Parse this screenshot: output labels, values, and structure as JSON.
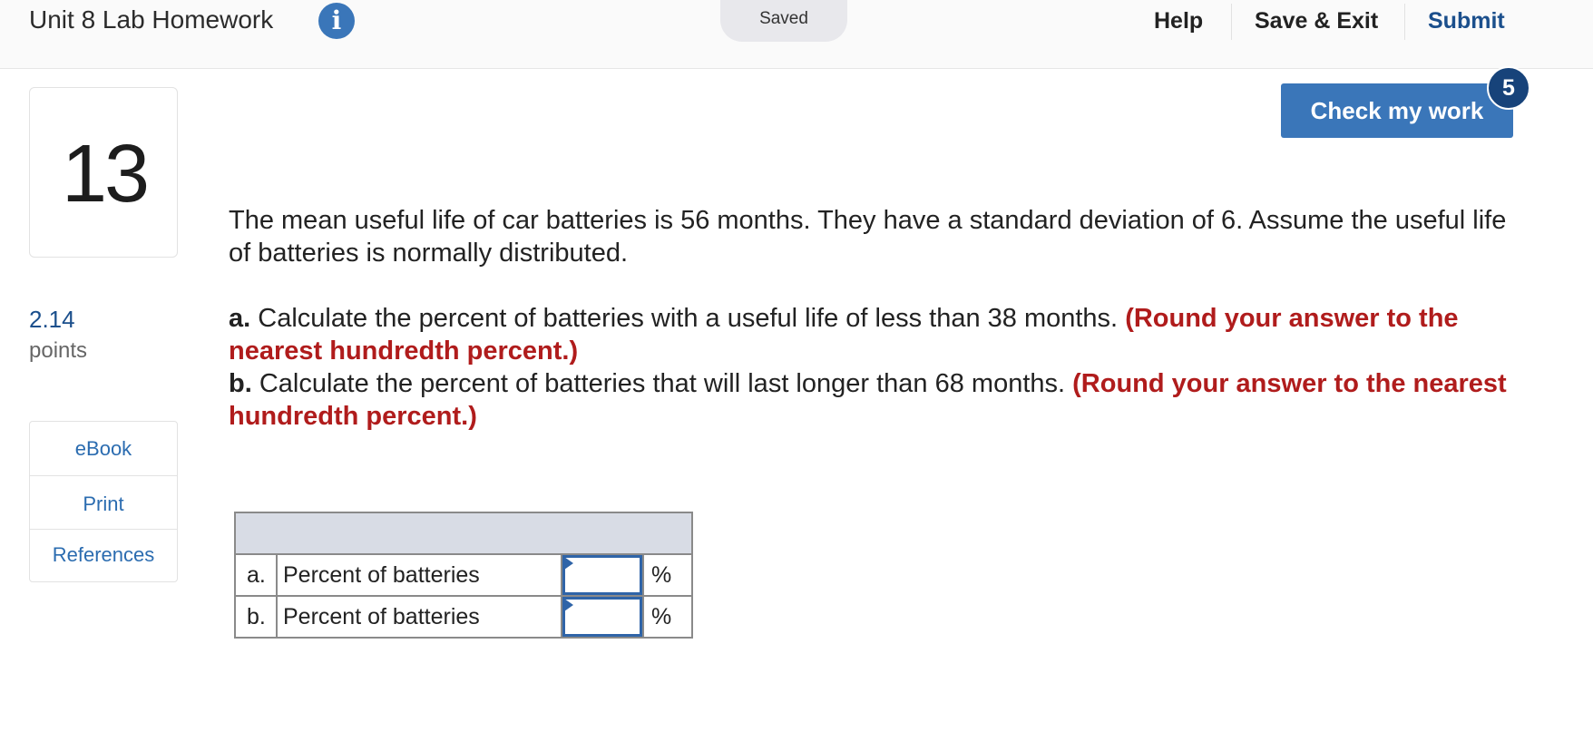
{
  "header": {
    "title": "Unit 8 Lab Homework",
    "info_icon": "info-icon",
    "saved_label": "Saved",
    "help_label": "Help",
    "save_exit_label": "Save & Exit",
    "submit_label": "Submit"
  },
  "check_work": {
    "label": "Check my work",
    "badge_count": "5"
  },
  "question": {
    "number": "13",
    "points_value": "2.14",
    "points_label": "points",
    "intro": "The mean useful life of car batteries is 56 months. They have a standard deviation of 6. Assume the useful life of batteries is normally distributed.",
    "part_a": {
      "letter": "a.",
      "text": "Calculate the percent of batteries with a useful life of less than 38 months.",
      "instruction": "(Round your answer to the nearest hundredth percent.)"
    },
    "part_b": {
      "letter": "b.",
      "text": "Calculate the percent of batteries that will last longer than 68 months.",
      "instruction": "(Round your answer to the nearest hundredth percent.)"
    }
  },
  "sidebar": {
    "items": [
      {
        "label": "eBook"
      },
      {
        "label": "Print"
      },
      {
        "label": "References"
      }
    ]
  },
  "answer_table": {
    "rows": [
      {
        "letter": "a.",
        "label": "Percent of batteries",
        "value": "",
        "unit": "%"
      },
      {
        "letter": "b.",
        "label": "Percent of batteries",
        "value": "",
        "unit": "%"
      }
    ]
  },
  "colors": {
    "accent_blue": "#3a76b9",
    "link_blue": "#2b6cb0",
    "submit_blue": "#1b4f8c",
    "instruction_red": "#b01c1c",
    "table_header": "#d8dce5"
  }
}
